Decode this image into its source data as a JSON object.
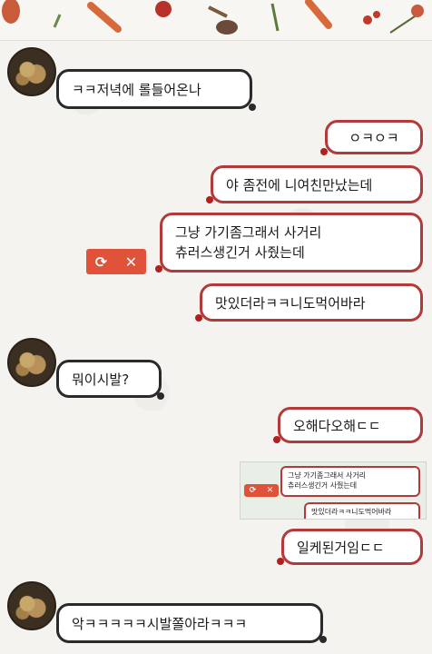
{
  "messages": [
    {
      "side": "left",
      "text": "ㅋㅋ저녁에 롤들어온나"
    },
    {
      "side": "right",
      "text": "ㅇㅋㅇㅋ"
    },
    {
      "side": "right",
      "text": "야 좀전에 니여친만났는데"
    },
    {
      "side": "right",
      "lines": [
        "그냥 가기좀그래서 사거리",
        "츄러스생긴거 사줬는데"
      ]
    },
    {
      "side": "right",
      "text": "맛있더라ㅋㅋ니도먹어바라"
    },
    {
      "side": "left",
      "text": "뭐이시발?"
    },
    {
      "side": "right",
      "text": "오해다오해ㄷㄷ"
    },
    {
      "side": "right",
      "text": "일케된거임ㄷㄷ"
    },
    {
      "side": "left",
      "text": "악ㅋㅋㅋㅋㅋ시발쫄아라ㅋㅋㅋ"
    }
  ],
  "failed_send": {
    "retry_icon": "retry-icon",
    "delete_icon": "close-icon",
    "retry": "⟳",
    "delete": "✕"
  },
  "quoted_screenshot": {
    "lines": [
      "그냥 가기좀그래서 사거리",
      "츄러스생긴거 사줬는데"
    ],
    "cropped_line": "맛있더라ㅋㅋ니도먹어바라",
    "retry": "⟳",
    "delete": "✕"
  },
  "colors": {
    "sent_border": "#b23a3a",
    "received_border": "#2a2a2a",
    "failed_send": "#e0533a"
  }
}
